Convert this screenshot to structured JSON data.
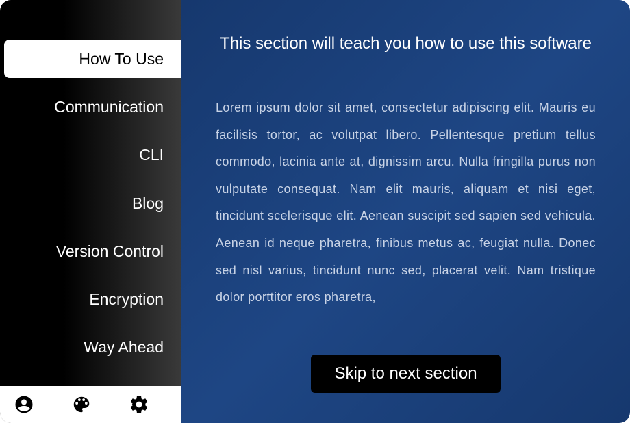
{
  "sidebar": {
    "items": [
      {
        "label": "How To Use",
        "active": true
      },
      {
        "label": "Communication",
        "active": false
      },
      {
        "label": "CLI",
        "active": false
      },
      {
        "label": "Blog",
        "active": false
      },
      {
        "label": "Version Control",
        "active": false
      },
      {
        "label": "Encryption",
        "active": false
      },
      {
        "label": "Way Ahead",
        "active": false
      }
    ]
  },
  "bottom_icons": {
    "user": "user-icon",
    "palette": "palette-icon",
    "settings": "gear-icon"
  },
  "main": {
    "title": "This section will teach you how to use this software",
    "body": "Lorem ipsum dolor sit amet, consectetur adipiscing elit. Mauris eu facilisis tortor, ac volutpat libero. Pellentesque pretium tellus commodo, lacinia ante at, dignissim arcu. Nulla fringilla purus non vulputate consequat. Nam elit mauris, aliquam et nisi eget, tincidunt scelerisque elit. Aenean suscipit sed sapien sed vehicula. Aenean id neque pharetra, finibus metus ac, feugiat nulla. Donec sed nisl varius, tincidunt nunc sed, placerat velit. Nam tristique dolor porttitor eros pharetra,",
    "skip_label": "Skip to next section"
  }
}
